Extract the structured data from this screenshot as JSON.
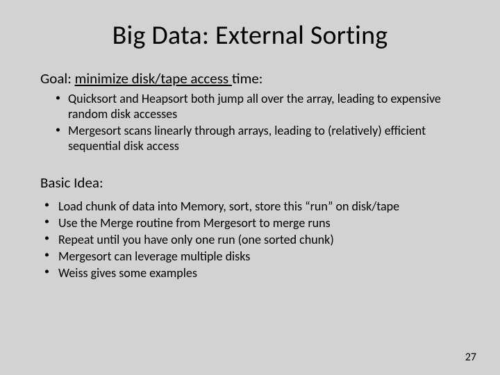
{
  "title": "Big Data: External Sorting",
  "goal": {
    "prefix": "Goal:  ",
    "underlined": "minimize disk/tape access ",
    "suffix": "time:"
  },
  "goal_bullets": [
    "Quicksort and Heapsort both jump all over the array, leading to expensive random disk accesses",
    "Mergesort scans linearly through arrays, leading to (relatively) efficient sequential disk access"
  ],
  "idea_head": "Basic Idea:",
  "idea_bullets": [
    "Load chunk of data into Memory, sort, store this “run” on disk/tape",
    "Use the Merge routine from Mergesort to merge runs",
    "Repeat until you have only one run (one sorted chunk)",
    "Mergesort can leverage multiple disks",
    "Weiss gives some examples"
  ],
  "page_number": "27"
}
